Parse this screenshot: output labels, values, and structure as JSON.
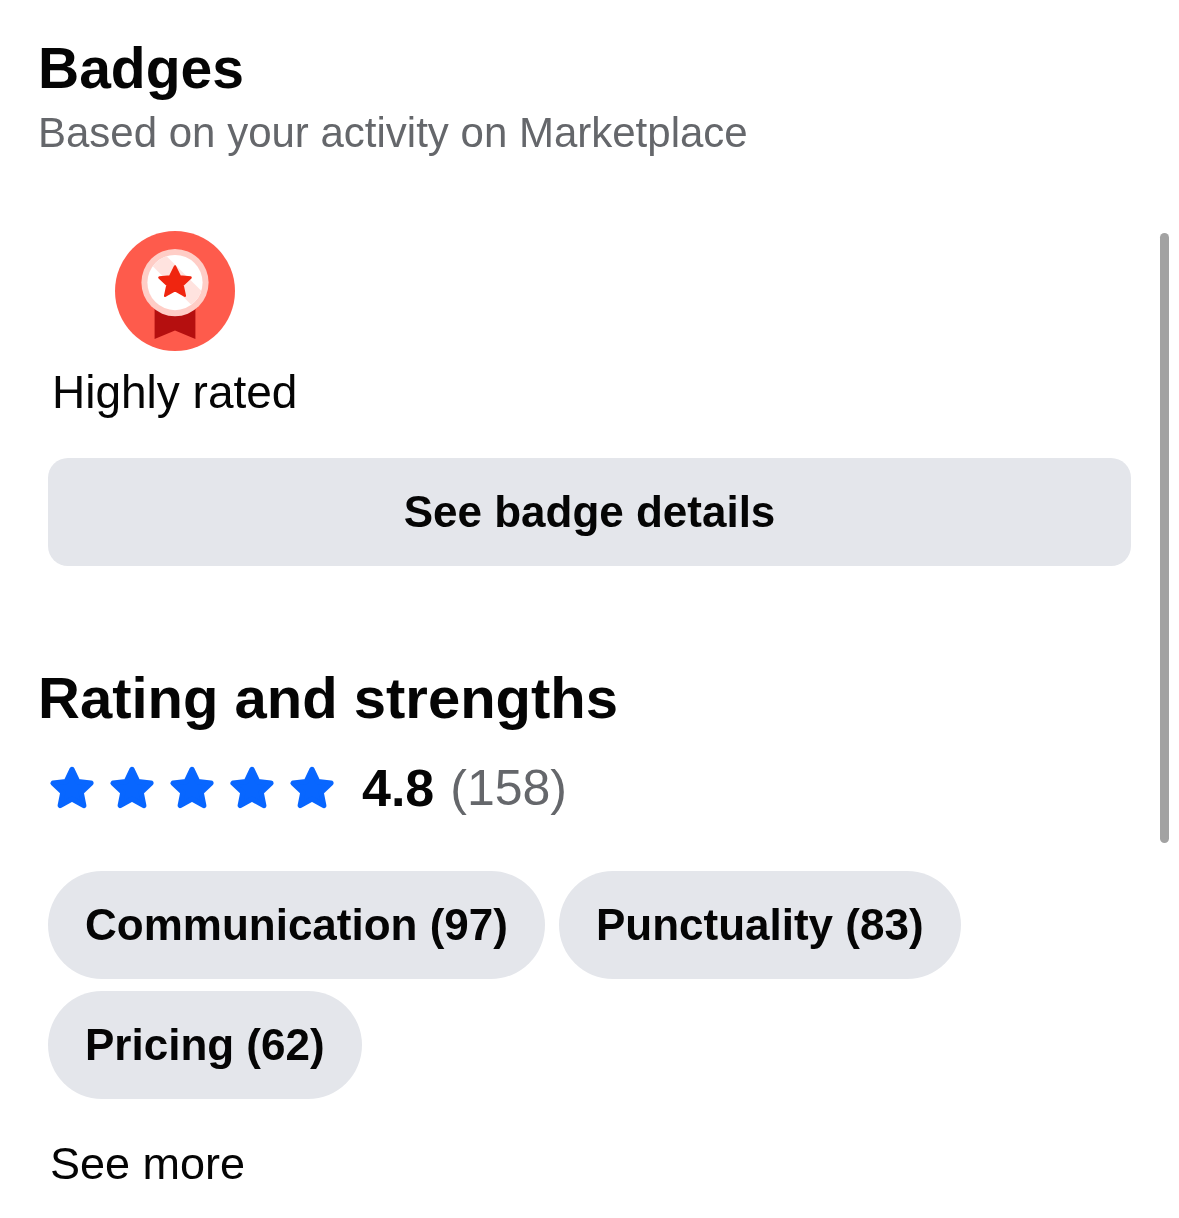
{
  "header": {
    "title": "Badges",
    "subtitle": "Based on your activity on Marketplace"
  },
  "badges": [
    {
      "label": "Highly rated"
    }
  ],
  "badge_details_button": "See badge details",
  "rating": {
    "title": "Rating and strengths",
    "stars": 5,
    "score": "4.8",
    "count": "(158)"
  },
  "strengths": [
    "Communication (97)",
    "Punctuality (83)",
    "Pricing (62)"
  ],
  "see_more": "See more"
}
